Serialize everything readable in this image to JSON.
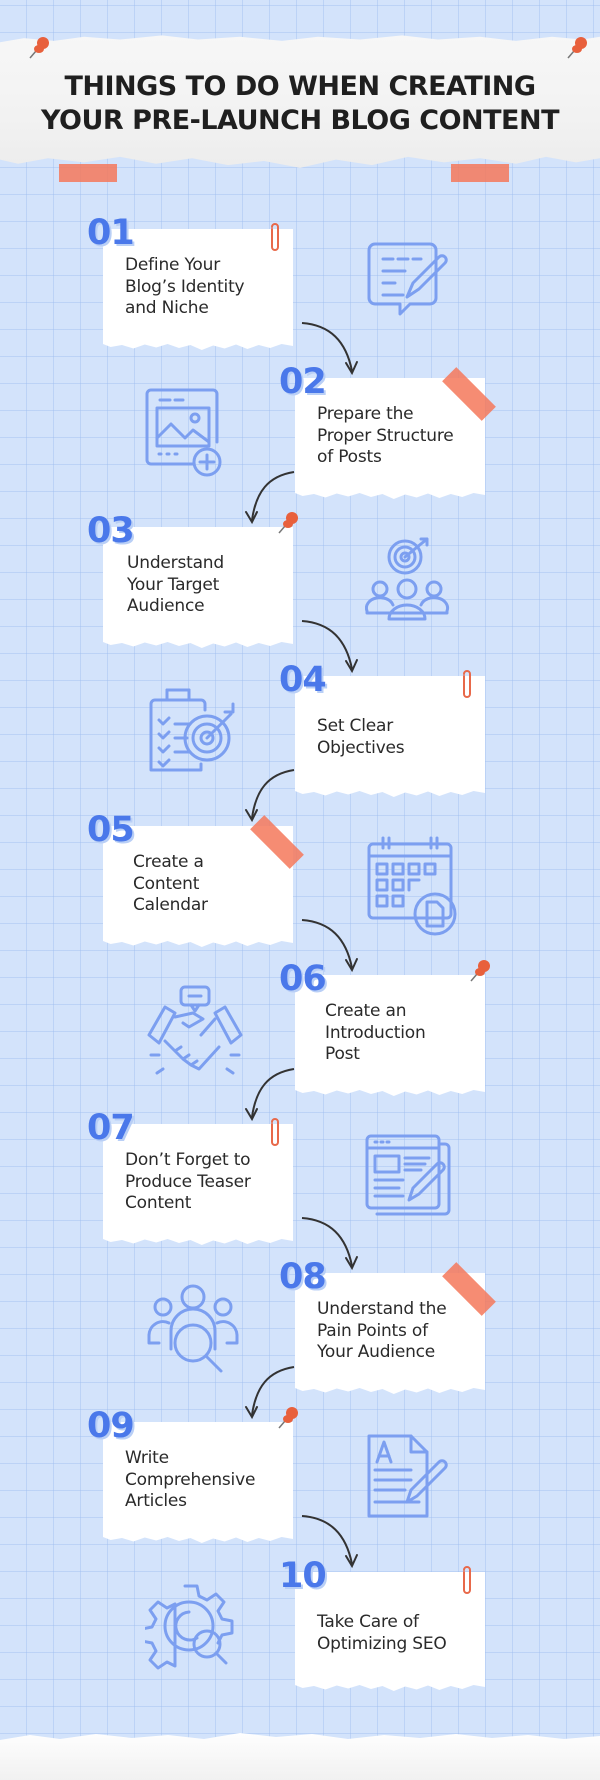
{
  "header": {
    "title_line1": "THINGS TO DO WHEN CREATING",
    "title_line2": "YOUR PRE-LAUNCH BLOG CONTENT"
  },
  "colors": {
    "background": "#d3e3fb",
    "accent_number": "#4a78ea",
    "tape": "#f5785a",
    "icon_stroke": "#7c9ff0",
    "arrow": "#333333"
  },
  "steps": [
    {
      "number": "01",
      "lines": [
        "Define Your",
        "Blog’s Identity",
        "and Niche"
      ],
      "icon": "edit-document-icon",
      "decoration": "paperclip"
    },
    {
      "number": "02",
      "lines": [
        "Prepare the",
        "Proper Structure",
        "of Posts"
      ],
      "icon": "add-image-icon",
      "decoration": "tape"
    },
    {
      "number": "03",
      "lines": [
        "Understand",
        "Your Target",
        "Audience"
      ],
      "icon": "target-audience-icon",
      "decoration": "pushpin"
    },
    {
      "number": "04",
      "lines": [
        "Set Clear",
        "Objectives"
      ],
      "icon": "clipboard-target-icon",
      "decoration": "paperclip"
    },
    {
      "number": "05",
      "lines": [
        "Create a",
        "Content",
        "Calendar"
      ],
      "icon": "calendar-document-icon",
      "decoration": "tape"
    },
    {
      "number": "06",
      "lines": [
        "Create an",
        "Introduction",
        "Post"
      ],
      "icon": "handshake-icon",
      "decoration": "pushpin"
    },
    {
      "number": "07",
      "lines": [
        "Don’t Forget to",
        "Produce Teaser",
        "Content"
      ],
      "icon": "web-page-edit-icon",
      "decoration": "paperclip"
    },
    {
      "number": "08",
      "lines": [
        "Understand the",
        "Pain Points of",
        "Your Audience"
      ],
      "icon": "audience-search-icon",
      "decoration": "tape"
    },
    {
      "number": "09",
      "lines": [
        "Write",
        "Comprehensive",
        "Articles"
      ],
      "icon": "article-write-icon",
      "decoration": "pushpin"
    },
    {
      "number": "10",
      "lines": [
        "Take Care of",
        "Optimizing SEO"
      ],
      "icon": "seo-gear-icon",
      "decoration": "paperclip"
    }
  ]
}
